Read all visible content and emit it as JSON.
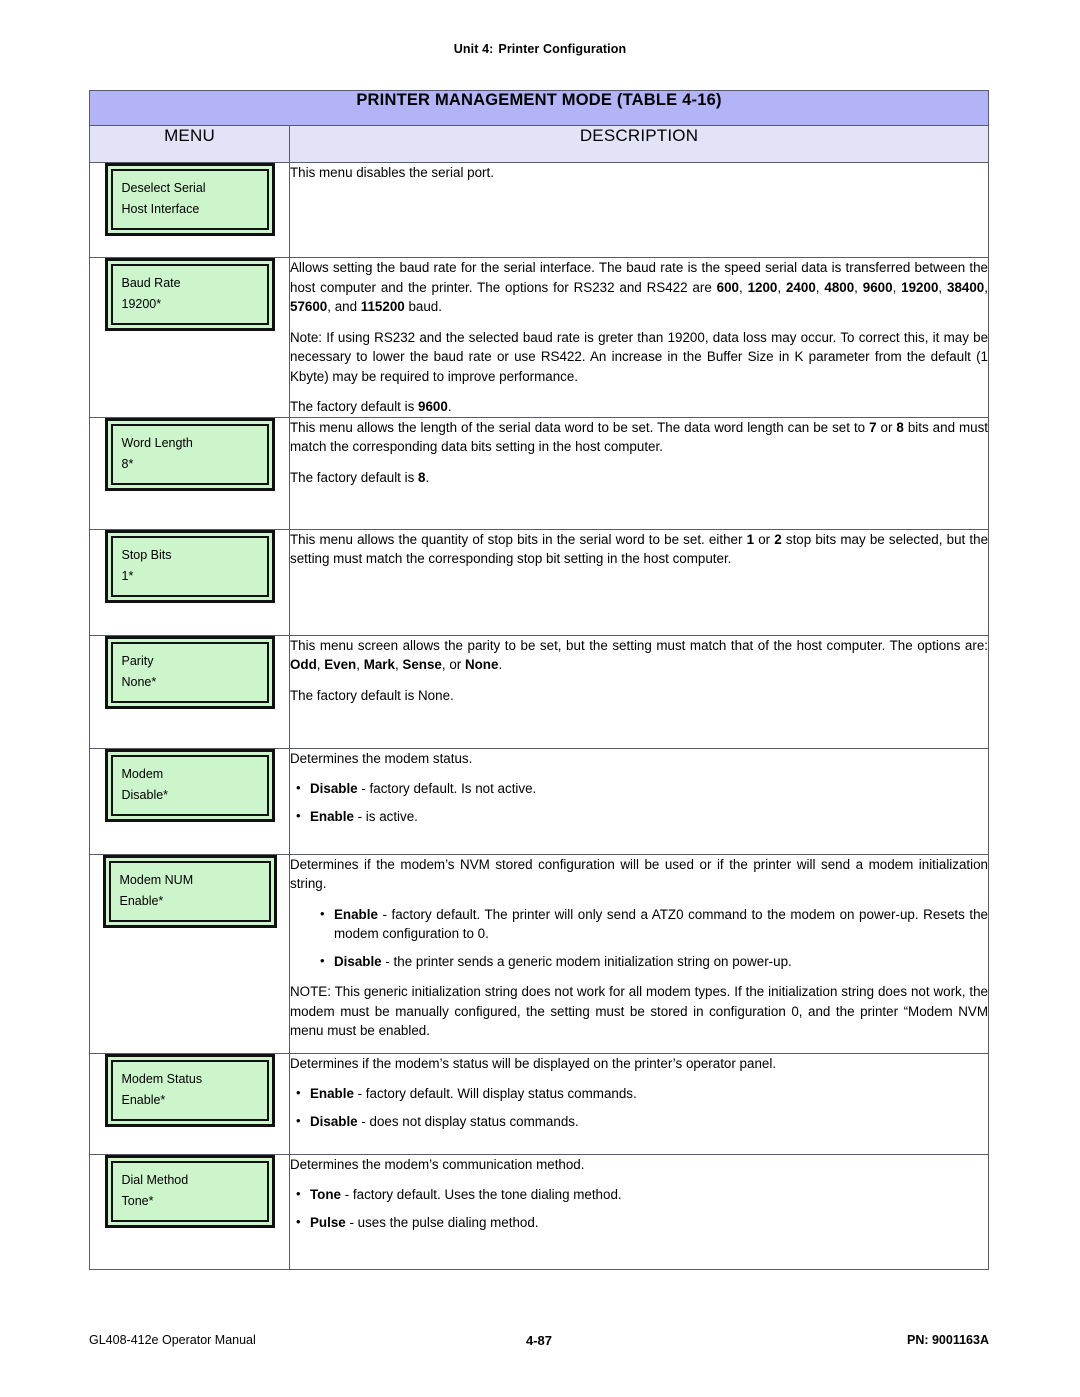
{
  "running_head": {
    "unit": "Unit 4:",
    "title": "Printer Configuration"
  },
  "table": {
    "title": "PRINTER MANAGEMENT MODE (TABLE 4-16)",
    "headers": {
      "menu": "MENU",
      "description": "DESCRIPTION"
    },
    "rows": [
      {
        "menu_box": {
          "line1": "Deselect Serial",
          "line2": "Host Interface"
        },
        "paragraphs": {
          "p1": "This menu disables the serial port."
        }
      },
      {
        "menu_box": {
          "line1": "Baud Rate",
          "line2": "19200*"
        },
        "paragraphs": {
          "p1_a": "Allows setting the baud rate for the serial interface. The baud rate is the speed serial data is transferred between the host computer and the printer. The options for RS232 and RS422 are ",
          "p1_b1": "600",
          "p1_sep1": ", ",
          "p1_b2": "1200",
          "p1_sep2": ", ",
          "p1_b3": "2400",
          "p1_sep3": ", ",
          "p1_b4": "4800",
          "p1_sep4": ", ",
          "p1_b5": "9600",
          "p1_sep5": ", ",
          "p1_b6": "19200",
          "p1_sep6": ", ",
          "p1_b7": "38400",
          "p1_sep7": ", ",
          "p1_b8": "57600",
          "p1_sep8": ", and ",
          "p1_b9": "115200",
          "p1_tail": " baud.",
          "p2": "Note: If using RS232 and the selected baud rate is greter than 19200, data loss may occur. To correct this, it may be necessary to lower the baud rate or use RS422. An increase in the Buffer Size in K parameter from the default (1 Kbyte) may be required to improve performance.",
          "p3_a": "The factory default is ",
          "p3_b": "9600",
          "p3_c": "."
        }
      },
      {
        "menu_box": {
          "line1": "Word Length",
          "line2": "8*"
        },
        "paragraphs": {
          "p1_a": "This menu allows the length of the serial data word to be set. The data word length can be set to ",
          "p1_b1": "7",
          "p1_mid": " or ",
          "p1_b2": "8",
          "p1_tail": " bits and must match the corresponding data bits setting in the host computer.",
          "p2_a": "The factory default is ",
          "p2_b": "8",
          "p2_c": "."
        }
      },
      {
        "menu_box": {
          "line1": "Stop Bits",
          "line2": "1*"
        },
        "paragraphs": {
          "p1_a": "This menu allows the quantity of stop bits in the serial word to be set. either ",
          "p1_b1": "1",
          "p1_mid": " or ",
          "p1_b2": "2",
          "p1_tail": " stop bits may be selected, but the setting must match the corresponding stop bit setting in the host computer."
        }
      },
      {
        "menu_box": {
          "line1": "Parity",
          "line2": "None*"
        },
        "paragraphs": {
          "p1_a": "This menu screen allows the parity to be set, but the setting must match that of the host computer. The options are: ",
          "p1_b1": "Odd",
          "p1_s1": ", ",
          "p1_b2": "Even",
          "p1_s2": ", ",
          "p1_b3": "Mark",
          "p1_s3": ", ",
          "p1_b4": "Sense",
          "p1_s4": ", or ",
          "p1_b5": "None",
          "p1_tail": ".",
          "p2": "The factory default is None."
        }
      },
      {
        "menu_box": {
          "line1": "Modem",
          "line2": "Disable*"
        },
        "paragraphs": {
          "p1": "Determines the modem status."
        },
        "bullets": [
          {
            "bold": "Disable",
            "rest": " - factory default. Is not active."
          },
          {
            "bold": "Enable",
            "rest": " - is active."
          }
        ]
      },
      {
        "menu_box": {
          "line1": "Modem NUM",
          "line2": "Enable*"
        },
        "paragraphs": {
          "p1": "Determines if the modem’s NVM stored configuration will be used or if the printer will send a modem initialization string.",
          "p2": "NOTE: This generic initialization string does not work for all modem types. If the initialization string does not work, the modem must be manually configured, the setting must be stored in configuration 0, and the printer “Modem NVM menu must be enabled."
        },
        "bullets": [
          {
            "bold": "Enable",
            "rest": " - factory default. The printer will only send a ATZ0 command to the modem on power-up. Resets the modem configuration to 0."
          },
          {
            "bold": "Disable",
            "rest": " - the printer sends a generic modem initialization string on power-up."
          }
        ]
      },
      {
        "menu_box": {
          "line1": "Modem Status",
          "line2": "Enable*"
        },
        "paragraphs": {
          "p1": "Determines if the modem’s status will be displayed on the printer’s operator panel."
        },
        "bullets": [
          {
            "bold": "Enable",
            "rest": " - factory default. Will display status commands."
          },
          {
            "bold": "Disable",
            "rest": " - does not display status commands."
          }
        ]
      },
      {
        "menu_box": {
          "line1": "Dial Method",
          "line2": "Tone*"
        },
        "paragraphs": {
          "p1": "Determines the modem’s communication method."
        },
        "bullets": [
          {
            "bold": "Tone",
            "rest": " - factory default. Uses the tone dialing method."
          },
          {
            "bold": "Pulse",
            "rest": " - uses the pulse dialing method."
          }
        ]
      }
    ]
  },
  "footer": {
    "left": "GL408-412e Operator Manual",
    "center": "4-87",
    "right": "PN: 9001163A"
  },
  "colors": {
    "title_bar": "#b3b3f7",
    "header_bar": "#e3e3f8",
    "lcd_fill": "#ccf5cc",
    "border": "#5a5a6e"
  }
}
